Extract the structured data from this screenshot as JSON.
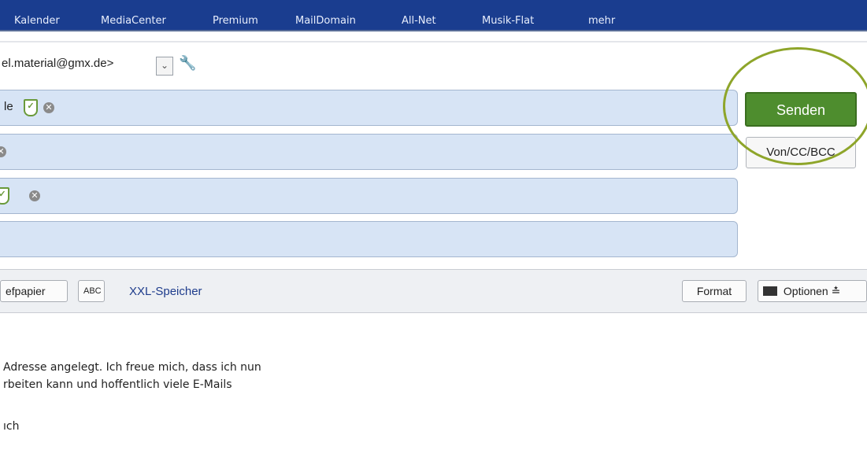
{
  "nav": {
    "items": [
      "Kalender",
      "MediaCenter",
      "Premium",
      "MailDomain",
      "All-Net",
      "Musik-Flat",
      "mehr"
    ]
  },
  "compose": {
    "from_value": "el.material@gmx.de>",
    "to_fragment": "le",
    "send_label": "Senden",
    "recipients_label": "Von/CC/BCC"
  },
  "toolbar": {
    "paper_label": "efpapier",
    "spell_label": "ABC",
    "xxl_label": "XXL-Speicher",
    "format_label": "Format",
    "options_label": "Optionen"
  },
  "body": {
    "line1": "Adresse angelegt. Ich freue mich, dass ich nun",
    "line2": "rbeiten kann und hoffentlich viele E-Mails",
    "line3": "ıch"
  },
  "icons": {
    "wrench": "wrench-icon",
    "shield": "shield-check-icon",
    "remove": "remove-circle-icon",
    "envelope": "envelope-icon",
    "chevron": "chevron-double-down-icon"
  },
  "colors": {
    "nav_bg": "#1a3d8f",
    "field_bg": "#d7e4f5",
    "send_bg": "#4e8d2e",
    "highlight_ellipse": "#8ea52a"
  }
}
